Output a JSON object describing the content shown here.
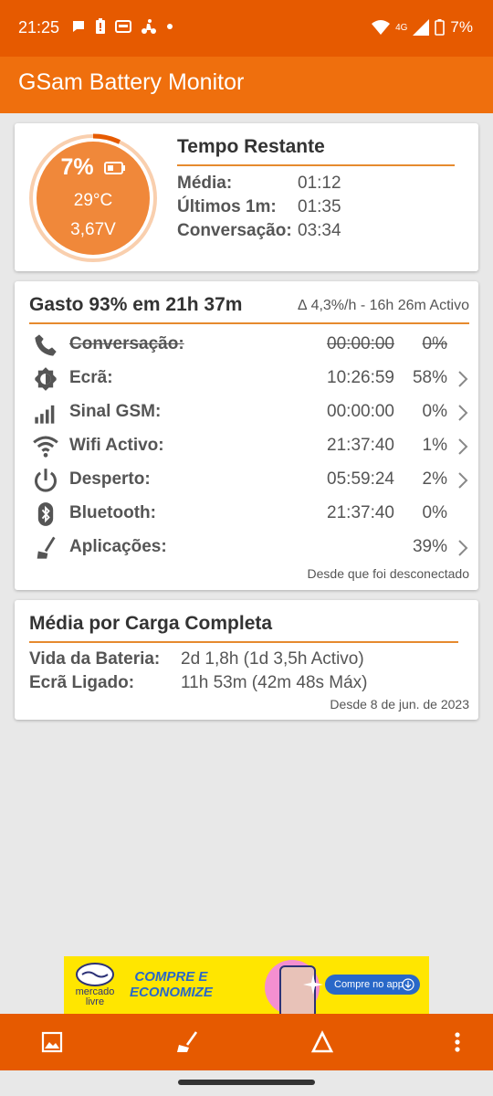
{
  "status": {
    "time": "21:25",
    "network": "4G",
    "battery_pct": "7%"
  },
  "app": {
    "title": "GSam Battery Monitor"
  },
  "summary": {
    "percent": "7%",
    "temperature": "29°C",
    "voltage": "3,67V",
    "ring_level": 0.07,
    "title": "Tempo Restante",
    "rows": [
      {
        "label": "Média:",
        "value": "01:12"
      },
      {
        "label": "Últimos 1m:",
        "value": "01:35"
      },
      {
        "label": "Conversação:",
        "value": "03:34"
      }
    ]
  },
  "usage": {
    "title": "Gasto 93% em 21h 37m",
    "rate": "∆ 4,3%/h - 16h 26m Activo",
    "rows": [
      {
        "icon": "phone-icon",
        "label": "Conversação:",
        "time": "00:00:00",
        "pct": "0%",
        "strike": true,
        "chevron": false
      },
      {
        "icon": "screen-brightness-icon",
        "label": "Ecrã:",
        "time": "10:26:59",
        "pct": "58%",
        "strike": false,
        "chevron": true
      },
      {
        "icon": "signal-bars-icon",
        "label": "Sinal GSM:",
        "time": "00:00:00",
        "pct": "0%",
        "strike": false,
        "chevron": true
      },
      {
        "icon": "wifi-icon",
        "label": "Wifi Activo:",
        "time": "21:37:40",
        "pct": "1%",
        "strike": false,
        "chevron": true
      },
      {
        "icon": "power-icon",
        "label": "Desperto:",
        "time": "05:59:24",
        "pct": "2%",
        "strike": false,
        "chevron": true
      },
      {
        "icon": "bluetooth-icon",
        "label": "Bluetooth:",
        "time": "21:37:40",
        "pct": "0%",
        "strike": false,
        "chevron": false
      },
      {
        "icon": "broom-icon",
        "label": "Aplicações:",
        "time": "",
        "pct": "39%",
        "strike": false,
        "chevron": true
      }
    ],
    "footnote": "Desde que foi desconectado"
  },
  "average": {
    "title": "Média por Carga Completa",
    "rows": [
      {
        "label": "Vida da Bateria:",
        "value": "2d 1,8h (1d 3,5h Activo)"
      },
      {
        "label": "Ecrã Ligado:",
        "value": "11h 53m (42m 48s Máx)"
      }
    ],
    "footnote": "Desde 8 de jun. de 2023"
  },
  "ad": {
    "brand_line1": "mercado",
    "brand_line2": "livre",
    "headline1": "COMPRE E",
    "headline2": "ECONOMIZE",
    "cta": "Compre no app"
  },
  "bottom_bar": {
    "buttons": [
      "image-icon",
      "broom-icon",
      "delta-icon",
      "more-vert-icon"
    ]
  },
  "colors": {
    "status_bar": "#e65a00",
    "app_bar": "#ef6f0d",
    "ring_fill": "#f0883a",
    "accent_line": "#e68a2e",
    "ad_background": "#ffe600"
  }
}
